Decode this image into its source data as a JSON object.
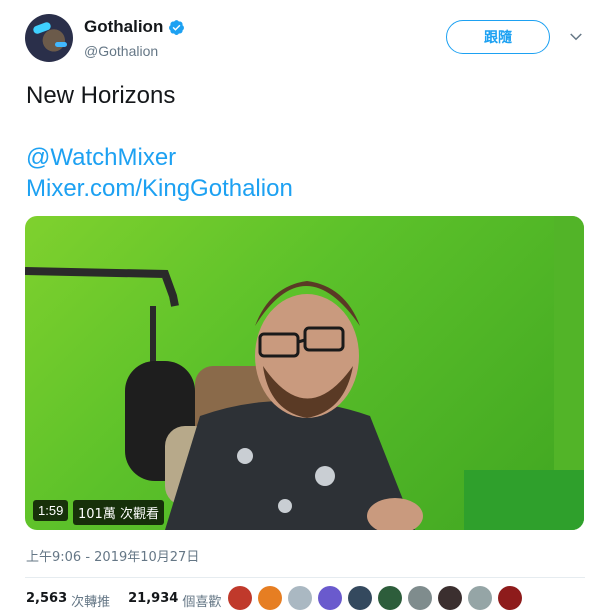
{
  "header": {
    "name": "Gothalion",
    "handle": "@Gothalion",
    "follow_label": "跟隨",
    "verified_icon": "verified-badge-icon",
    "menu_icon": "chevron-down-icon"
  },
  "tweet": {
    "text": "New Horizons",
    "links": [
      "@WatchMixer",
      "Mixer.com/KingGothalion"
    ]
  },
  "video": {
    "duration": "1:59",
    "views": "101萬 次觀看"
  },
  "timestamp": "上午9:06 - 2019年10月27日",
  "stats": {
    "retweets_count": "2,563",
    "retweets_label": "次轉推",
    "likes_count": "21,934",
    "likes_label": "個喜歡"
  },
  "likers": [
    "#c0392b",
    "#e67e22",
    "#aab8c2",
    "#6a5acd",
    "#34495e",
    "#2d5d3b",
    "#7f8c8d",
    "#3b2f2f",
    "#95a5a6",
    "#8e1b1b"
  ],
  "colors": {
    "accent": "#1da1f2",
    "text": "#14171a",
    "muted": "#657786",
    "video_green": "#5cc12a"
  }
}
